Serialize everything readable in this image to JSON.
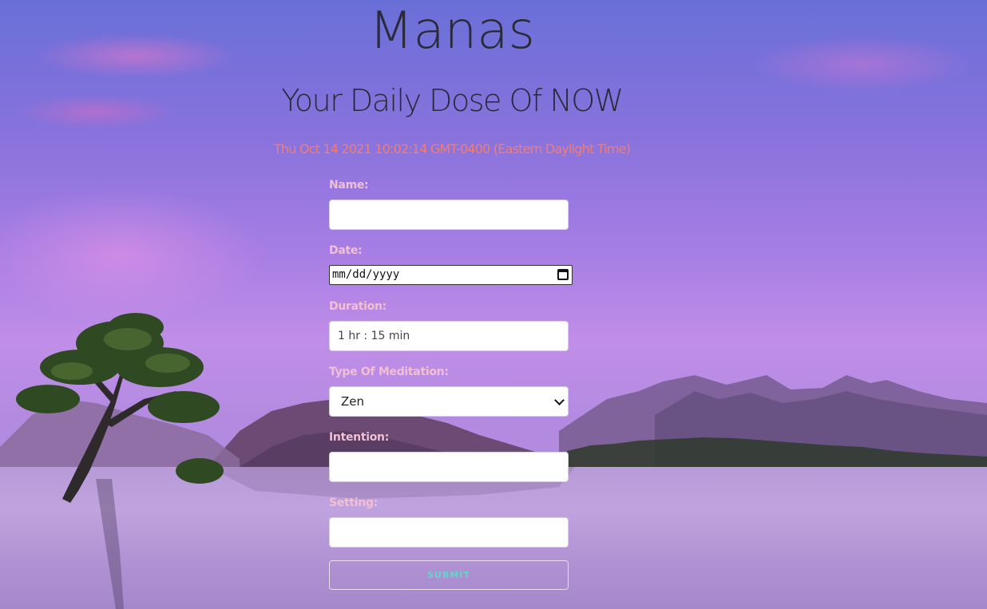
{
  "app": {
    "title": "Manas",
    "subtitle": "Your Daily Dose Of NOW",
    "datetime": "Thu Oct 14 2021 10:02:14 GMT-0400 (Eastern Daylight Time)"
  },
  "form": {
    "name": {
      "label": "Name:",
      "value": ""
    },
    "date": {
      "label": "Date:",
      "value": "mm/dd/yyyy"
    },
    "duration": {
      "label": "Duration:",
      "value": "1 hr : 15 min"
    },
    "type": {
      "label": "Type Of Meditation:",
      "selected": "Zen"
    },
    "intention": {
      "label": "Intention:",
      "value": ""
    },
    "setting": {
      "label": "Setting:",
      "value": ""
    },
    "submit_label": "SUBMIT"
  },
  "icons": {
    "date_picker": "calendar-icon",
    "select_arrow": "chevron-down-icon"
  },
  "colors": {
    "heading": "#2a2a3a",
    "datetime": "#f07e74",
    "label": "#f3bfd2",
    "submit_text": "#5fd7c4"
  }
}
